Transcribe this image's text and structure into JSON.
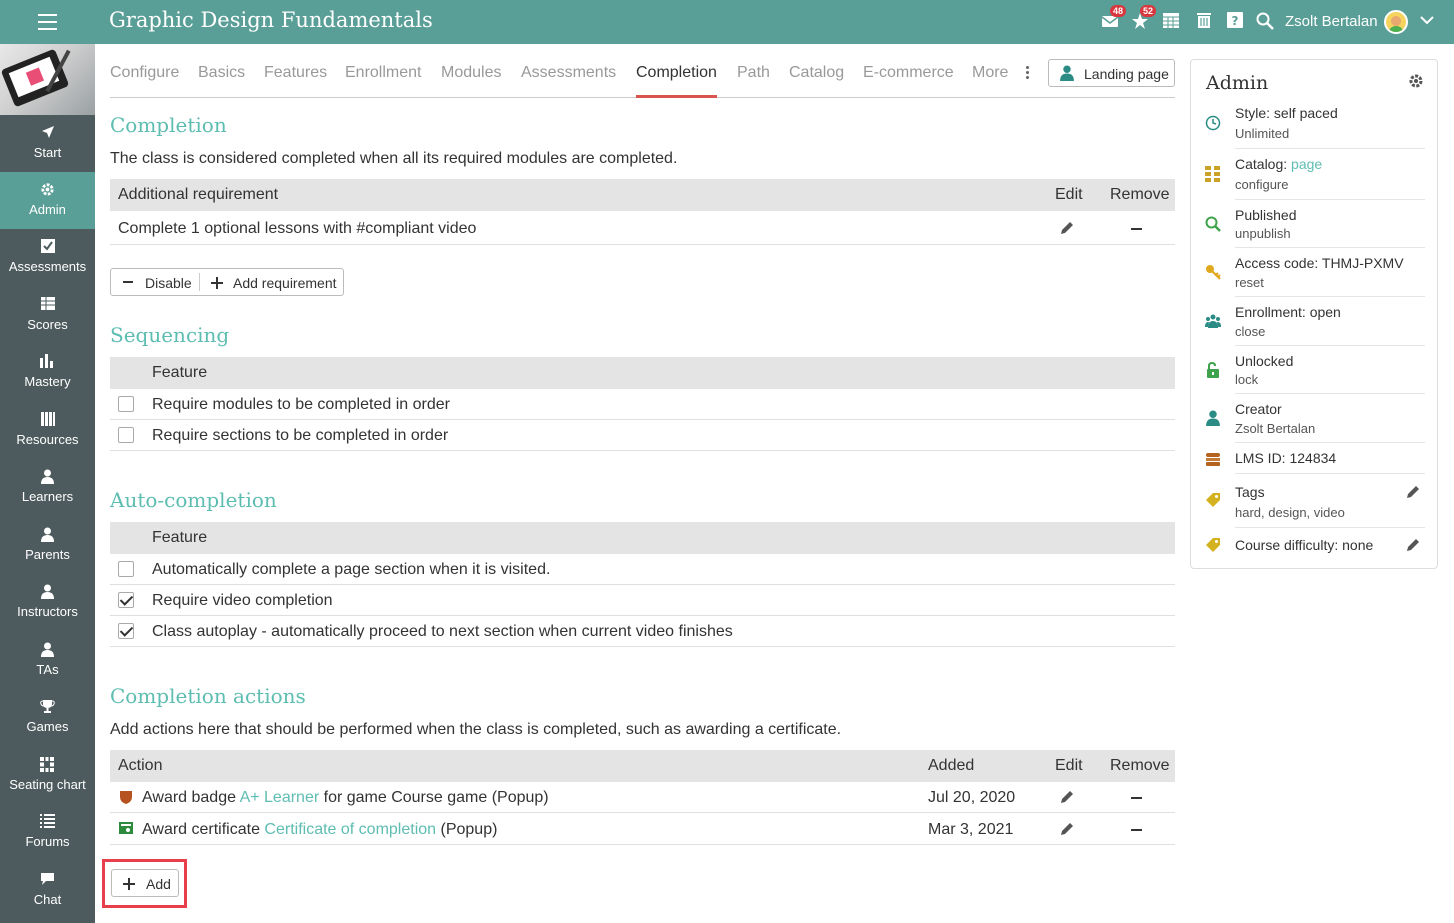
{
  "app": {
    "title": "Graphic Design Fundamentals"
  },
  "header": {
    "messages_count": "48",
    "notifications_count": "52",
    "user_name": "Zsolt Bertalan"
  },
  "sidebar": {
    "items": [
      {
        "label": "Start",
        "icon": "arrow-icon"
      },
      {
        "label": "Admin",
        "icon": "gear-icon",
        "active": true
      },
      {
        "label": "Assessments",
        "icon": "checkbox-icon"
      },
      {
        "label": "Scores",
        "icon": "grid-icon"
      },
      {
        "label": "Mastery",
        "icon": "bar-chart-icon"
      },
      {
        "label": "Resources",
        "icon": "books-icon"
      },
      {
        "label": "Learners",
        "icon": "person-icon"
      },
      {
        "label": "Parents",
        "icon": "person-icon"
      },
      {
        "label": "Instructors",
        "icon": "person-icon"
      },
      {
        "label": "TAs",
        "icon": "person-icon"
      },
      {
        "label": "Games",
        "icon": "trophy-icon"
      },
      {
        "label": "Seating chart",
        "icon": "seats-icon"
      },
      {
        "label": "Forums",
        "icon": "list-icon"
      },
      {
        "label": "Chat",
        "icon": "chat-icon"
      }
    ]
  },
  "tabs": [
    {
      "label": "Configure"
    },
    {
      "label": "Basics"
    },
    {
      "label": "Features"
    },
    {
      "label": "Enrollment"
    },
    {
      "label": "Modules"
    },
    {
      "label": "Assessments"
    },
    {
      "label": "Completion",
      "active": true
    },
    {
      "label": "Path"
    },
    {
      "label": "Catalog"
    },
    {
      "label": "E-commerce"
    },
    {
      "label": "More"
    }
  ],
  "landing_button": "Landing page",
  "completion": {
    "title": "Completion",
    "description": "The class is considered completed when all its required modules are completed.",
    "headers": {
      "requirement": "Additional requirement",
      "edit": "Edit",
      "remove": "Remove"
    },
    "rows": [
      {
        "requirement": "Complete 1 optional lessons with #compliant video"
      }
    ],
    "disable_label": "Disable",
    "add_requirement_label": "Add requirement"
  },
  "sequencing": {
    "title": "Sequencing",
    "header": "Feature",
    "rows": [
      {
        "label": "Require modules to be completed in order",
        "checked": false
      },
      {
        "label": "Require sections to be completed in order",
        "checked": false
      }
    ]
  },
  "autocompletion": {
    "title": "Auto-completion",
    "header": "Feature",
    "rows": [
      {
        "label": "Automatically complete a page section when it is visited.",
        "checked": false
      },
      {
        "label": "Require video completion",
        "checked": true
      },
      {
        "label": "Class autoplay - automatically proceed to next section when current video finishes",
        "checked": true
      }
    ]
  },
  "actions": {
    "title": "Completion actions",
    "description": "Add actions here that should be performed when the class is completed, such as awarding a certificate.",
    "headers": {
      "action": "Action",
      "added": "Added",
      "edit": "Edit",
      "remove": "Remove"
    },
    "rows": [
      {
        "prefix": "Award badge ",
        "link": "A+ Learner",
        "suffix": " for game Course game (Popup)",
        "added": "Jul 20, 2020",
        "icon": "badge-icon"
      },
      {
        "prefix": "Award certificate ",
        "link": "Certificate of completion",
        "suffix": " (Popup)",
        "added": "Mar 3, 2021",
        "icon": "certificate-icon"
      }
    ],
    "add_label": "Add"
  },
  "admin_panel": {
    "title": "Admin",
    "style_label": "Style: self paced",
    "style_sub": "Unlimited",
    "catalog_label": "Catalog: ",
    "catalog_link": "page",
    "catalog_sub": "configure",
    "published_label": "Published",
    "published_sub": "unpublish",
    "access_label": "Access code: THMJ-PXMV",
    "access_sub": "reset",
    "enrollment_label": "Enrollment: open",
    "enrollment_sub": "close",
    "unlocked_label": "Unlocked",
    "unlocked_sub": "lock",
    "creator_label": "Creator",
    "creator_sub": "Zsolt Bertalan",
    "lms_label": "LMS ID: 124834",
    "tags_label": "Tags",
    "tags_sub": "hard, design, video",
    "difficulty_label": "Course difficulty: none"
  },
  "colors": {
    "header": "#5a9f97",
    "sidebar": "#4e5b5e",
    "accent": "#5dbdb1",
    "highlight": "#e83f4d"
  }
}
